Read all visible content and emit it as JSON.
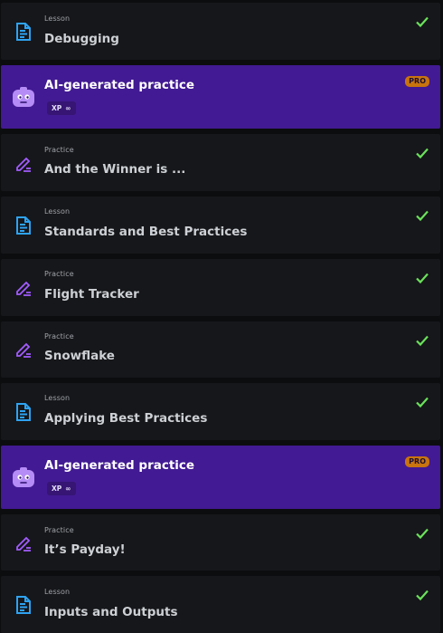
{
  "items": [
    {
      "kind": "Lesson",
      "title": "Debugging",
      "icon": "lesson-icon",
      "done": true
    },
    {
      "kind": "",
      "title": "AI-generated practice",
      "icon": "robot-icon",
      "badge": "PRO",
      "xp": "XP",
      "xp_value": "∞"
    },
    {
      "kind": "Practice",
      "title": "And the Winner is ...",
      "icon": "practice-icon",
      "done": true
    },
    {
      "kind": "Lesson",
      "title": "Standards and Best Practices",
      "icon": "lesson-icon",
      "done": true
    },
    {
      "kind": "Practice",
      "title": "Flight Tracker",
      "icon": "practice-icon",
      "done": true
    },
    {
      "kind": "Practice",
      "title": "Snowflake",
      "icon": "practice-icon",
      "done": true
    },
    {
      "kind": "Lesson",
      "title": "Applying Best Practices",
      "icon": "lesson-icon",
      "done": true
    },
    {
      "kind": "",
      "title": "AI-generated practice",
      "icon": "robot-icon",
      "badge": "PRO",
      "xp": "XP",
      "xp_value": "∞"
    },
    {
      "kind": "Practice",
      "title": "It’s Payday!",
      "icon": "practice-icon",
      "done": true
    },
    {
      "kind": "Lesson",
      "title": "Inputs and Outputs",
      "icon": "lesson-icon",
      "done": true
    }
  ],
  "colors": {
    "lesson_icon": "#2ea3f2",
    "practice_icon": "#a35cff",
    "check": "#6be15c",
    "ai_background": "#421a93",
    "pro_badge": "#c9740e"
  }
}
